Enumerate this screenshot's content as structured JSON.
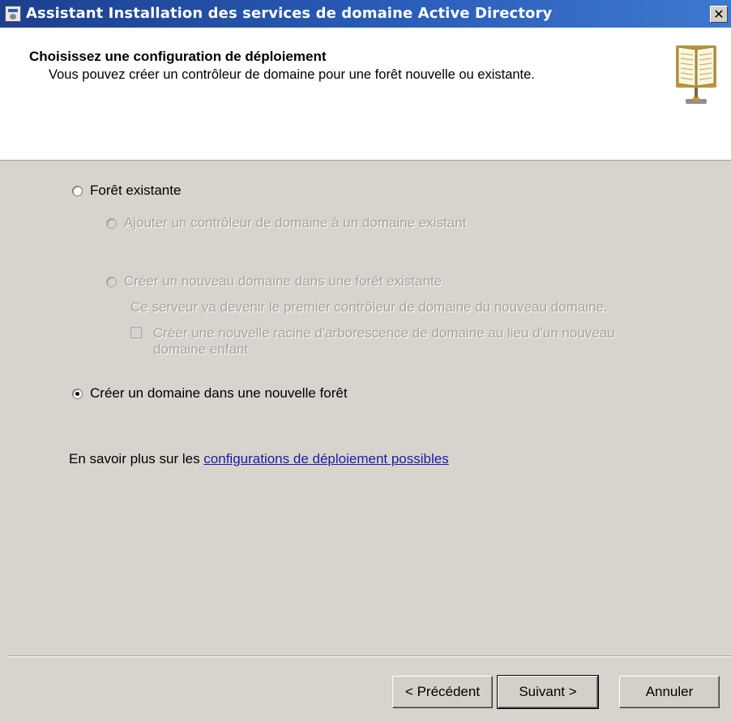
{
  "window": {
    "title": "Assistant Installation des services de domaine Active Directory",
    "close_glyph": "✕"
  },
  "header": {
    "title": "Choisissez une configuration de déploiement",
    "subtitle": "Vous pouvez créer un contrôleur de domaine pour une forêt nouvelle ou existante.",
    "icon": "book-icon"
  },
  "options": {
    "existing_forest": {
      "label": "Forêt existante",
      "selected": false,
      "enabled": true
    },
    "add_dc_existing_domain": {
      "label": "Ajouter un contrôleur de domaine à un domaine existant",
      "selected": false,
      "enabled": false
    },
    "new_domain_existing_forest": {
      "label": "Créer un nouveau domaine dans une forêt existante",
      "description": "Ce serveur va devenir le premier contrôleur de domaine du nouveau domaine.",
      "selected": false,
      "enabled": false
    },
    "new_tree_root": {
      "label_line1": "Créer une nouvelle racine d'arborescence de domaine au lieu d'un nouveau",
      "label_line2": "domaine enfant",
      "checked": false,
      "enabled": false
    },
    "new_forest": {
      "label": "Créer un domaine dans une nouvelle forêt",
      "selected": true,
      "enabled": true
    }
  },
  "learn_more": {
    "prefix": "En savoir plus sur les ",
    "link_text": "configurations de déploiement possibles"
  },
  "buttons": {
    "back": "< Précédent",
    "next": "Suivant >",
    "cancel": "Annuler"
  }
}
